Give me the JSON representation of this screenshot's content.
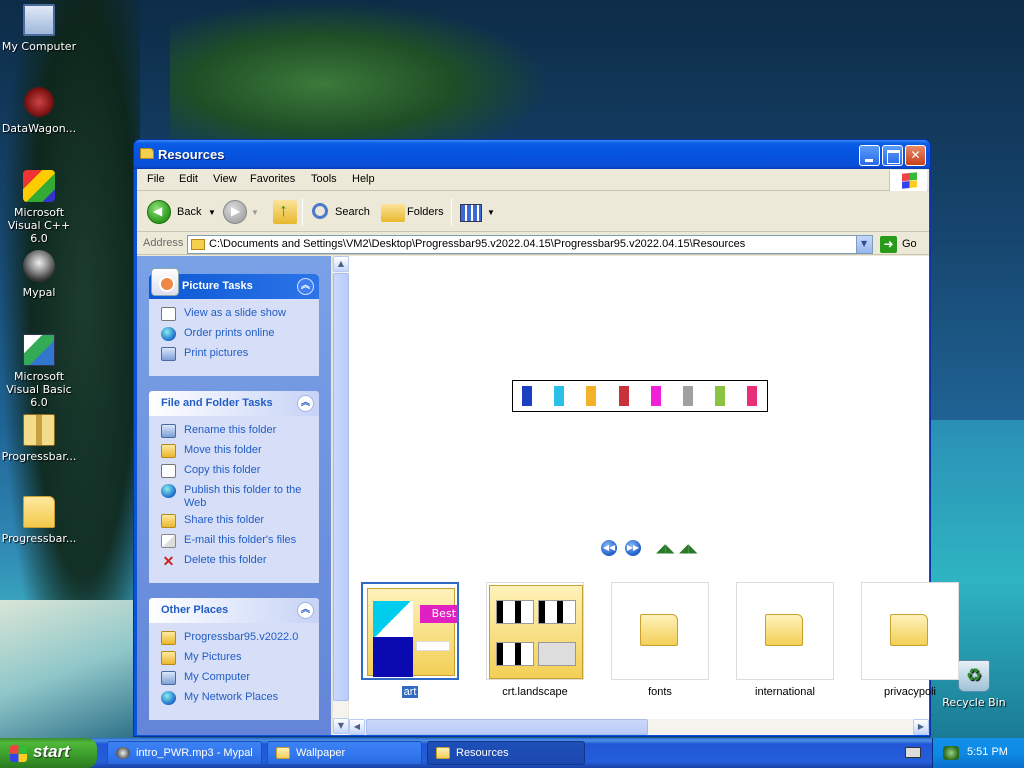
{
  "desktop": {
    "icons": [
      {
        "label": "My Computer",
        "icon": "computer-icon"
      },
      {
        "label": "DataWagon...",
        "icon": "datawagon-icon"
      },
      {
        "label": "Microsoft Visual C++ 6.0",
        "icon": "visual-cpp-icon"
      },
      {
        "label": "Mypal",
        "icon": "mypal-icon"
      },
      {
        "label": "Microsoft Visual Basic 6.0",
        "icon": "visual-basic-icon"
      },
      {
        "label": "Progressbar...",
        "icon": "zip-icon"
      },
      {
        "label": "Progressbar...",
        "icon": "folder-icon"
      },
      {
        "label": "Recycle Bin",
        "icon": "recycle-bin-icon"
      }
    ]
  },
  "window": {
    "title": "Resources",
    "menu": [
      "File",
      "Edit",
      "View",
      "Favorites",
      "Tools",
      "Help"
    ],
    "toolbar": {
      "back": "Back",
      "search": "Search",
      "folders": "Folders"
    },
    "address": {
      "label": "Address",
      "value": "C:\\Documents and Settings\\VM2\\Desktop\\Progressbar95.v2022.04.15\\Progressbar95.v2022.04.15\\Resources",
      "go": "Go"
    },
    "panels": {
      "picture": {
        "title": "Picture Tasks",
        "tasks": [
          "View as a slide show",
          "Order prints online",
          "Print pictures"
        ]
      },
      "file": {
        "title": "File and Folder Tasks",
        "tasks": [
          "Rename this folder",
          "Move this folder",
          "Copy this folder",
          "Publish this folder to the Web",
          "Share this folder",
          "E-mail this folder's files",
          "Delete this folder"
        ]
      },
      "other": {
        "title": "Other Places",
        "places": [
          "Progressbar95.v2022.0",
          "My Pictures",
          "My Computer",
          "My Network Places"
        ]
      }
    },
    "preview": {
      "bar_colors": [
        "#1a3fc0",
        "#2bc0e8",
        "#f4b22a",
        "#c8303a",
        "#f020d8",
        "#a0a0a0",
        "#8ac440",
        "#e8307a"
      ]
    },
    "thumbnails": [
      {
        "label": "art",
        "selected": true
      },
      {
        "label": "crt.landscape",
        "selected": false
      },
      {
        "label": "fonts",
        "selected": false
      },
      {
        "label": "international",
        "selected": false
      },
      {
        "label": "privacypoli",
        "selected": false
      }
    ],
    "art_thumb_text": "Best"
  },
  "taskbar": {
    "start": "start",
    "tasks": [
      {
        "label": "intro_PWR.mp3 - Mypal",
        "active": false
      },
      {
        "label": "Wallpaper",
        "active": false
      },
      {
        "label": "Resources",
        "active": true
      }
    ],
    "clock": "5:51 PM"
  }
}
